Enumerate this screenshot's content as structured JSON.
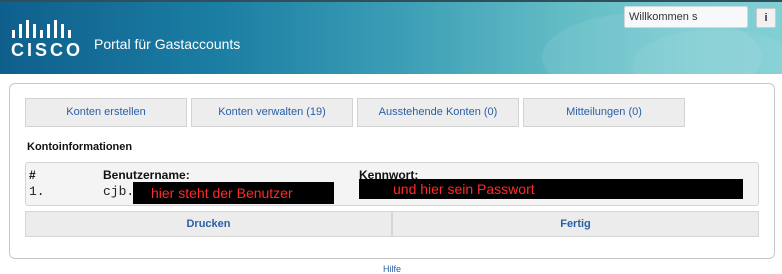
{
  "header": {
    "logo_text": "CISCO",
    "title": "Portal für Gastaccounts",
    "welcome_value": "Willkommen s",
    "info_label": "i"
  },
  "tabs": [
    {
      "label": "Konten erstellen"
    },
    {
      "label": "Konten verwalten (19)"
    },
    {
      "label": "Ausstehende Konten (0)"
    },
    {
      "label": "Mitteilungen (0)"
    }
  ],
  "account_info": {
    "section_title": "Kontoinformationen",
    "col_number": "#",
    "col_username": "Benutzername:",
    "col_password": "Kennwort:",
    "row_number": "1.",
    "username_visible": "cjb.",
    "username_redaction_note": "hier steht der Benutzer",
    "password_redaction_note": "und hier sein Passwort"
  },
  "actions": {
    "print_label": "Drucken",
    "done_label": "Fertig"
  },
  "footer": {
    "help_label": "Hilfe"
  },
  "icons": {
    "cisco_logo": "cisco-logo-icon",
    "info": "info-icon"
  },
  "colors": {
    "header_dark": "#0f5f8d",
    "header_light": "#81cfd4",
    "link_blue": "#2a5fa6",
    "redaction_text": "#ff2a2a"
  }
}
